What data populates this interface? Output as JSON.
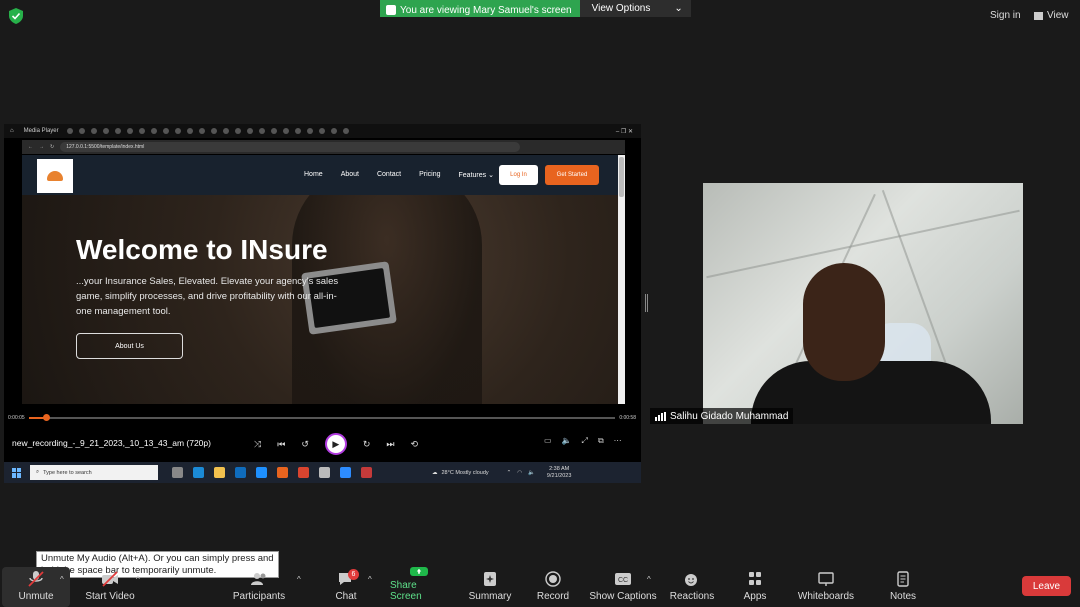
{
  "topbar": {
    "viewing_text": "You are viewing Mary Samuel's screen",
    "view_options": "View Options",
    "sign_in": "Sign in",
    "view": "View"
  },
  "colors": {
    "banner_green": "#2ea44f",
    "accent_orange": "#e8641f",
    "leave_red": "#d93a3a"
  },
  "shared_screen": {
    "window_title": "Media Player",
    "url": "127.0.0.1:5500/template/index.html",
    "site": {
      "nav": [
        "Home",
        "About",
        "Contact",
        "Pricing",
        "Features"
      ],
      "login": "Log In",
      "get_started": "Get Started",
      "hero_title": "Welcome to INsure",
      "hero_desc": "...your Insurance Sales, Elevated. Elevate your agency's sales game, simplify processes, and drive profitability with our all-in-one management tool.",
      "about_button": "About Us"
    },
    "player": {
      "time_elapsed": "0:00:05",
      "time_total": "0:00:58",
      "progress": 0.03,
      "filename": "new_recording_-_9_21_2023,_10_13_43_am (720p)"
    },
    "taskbar": {
      "search_placeholder": "Type here to search",
      "weather": "28°C  Mostly cloudy",
      "time": "2:38 AM",
      "date": "9/21/2023"
    }
  },
  "participant": {
    "name": "Salihu Gidado Muhammad"
  },
  "tooltip": "Unmute My Audio (Alt+A). Or you can simply press and hold the space bar to temporarily unmute.",
  "toolbar": {
    "unmute": "Unmute",
    "start_video": "Start Video",
    "participants": "Participants",
    "chat": "Chat",
    "chat_badge": "6",
    "share_screen": "Share Screen",
    "summary": "Summary",
    "record": "Record",
    "show_captions": "Show Captions",
    "reactions": "Reactions",
    "apps": "Apps",
    "whiteboards": "Whiteboards",
    "notes": "Notes",
    "leave": "Leave"
  }
}
